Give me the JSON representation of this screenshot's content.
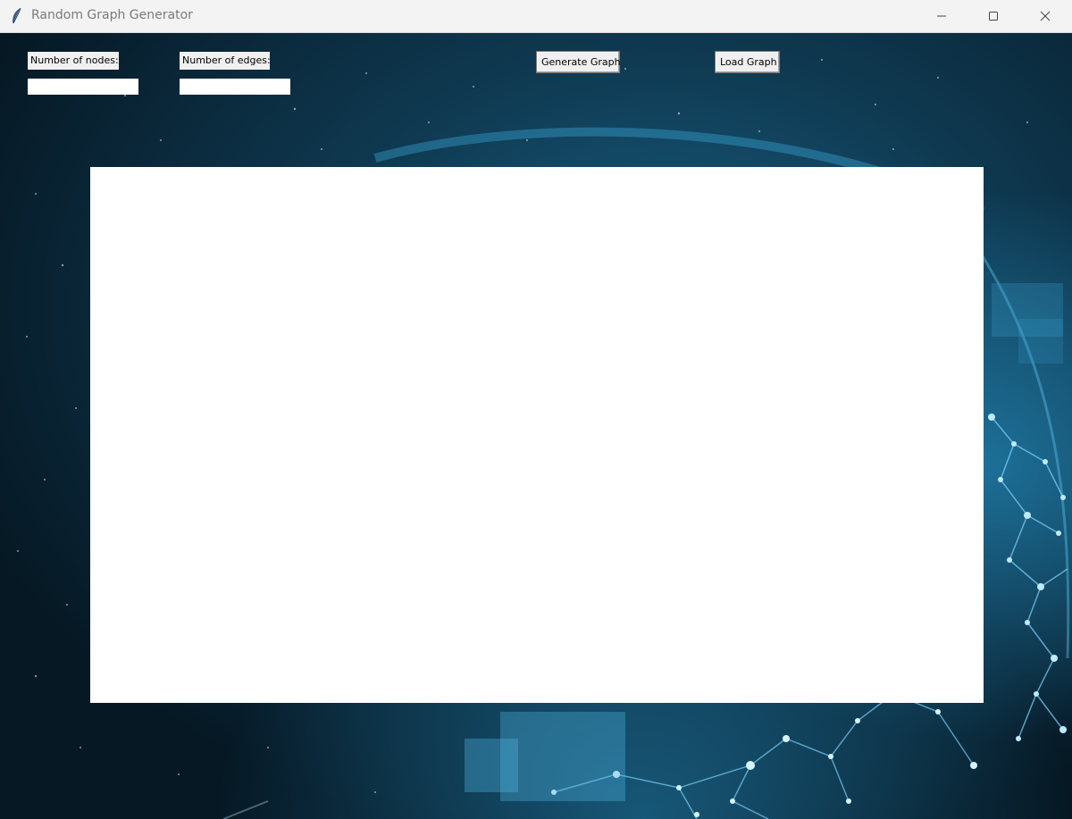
{
  "window": {
    "title": "Random Graph Generator"
  },
  "form": {
    "nodes_label": "Number of nodes:",
    "nodes_value": "",
    "edges_label": "Number of edges:",
    "edges_value": ""
  },
  "toolbar": {
    "generate_label": "Generate Graph",
    "load_label": "Load Graph"
  },
  "icons": {
    "app": "feather-icon",
    "minimize": "minimize-icon",
    "maximize": "maximize-icon",
    "close": "close-icon"
  },
  "colors": {
    "background_dark": "#0a2232",
    "glow": "#2a9fd6",
    "canvas": "#ffffff"
  }
}
